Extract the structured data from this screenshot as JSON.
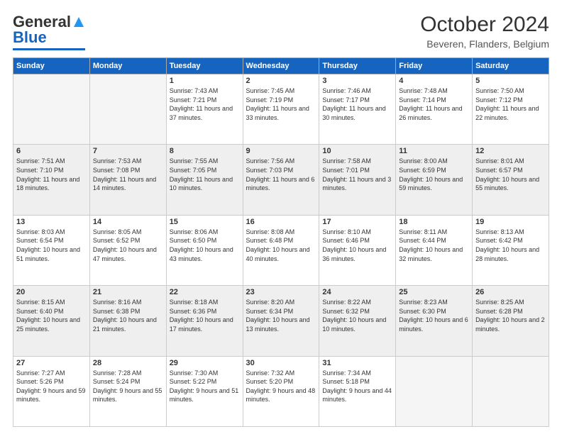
{
  "header": {
    "logo_general": "General",
    "logo_blue": "Blue",
    "month_year": "October 2024",
    "location": "Beveren, Flanders, Belgium"
  },
  "days_of_week": [
    "Sunday",
    "Monday",
    "Tuesday",
    "Wednesday",
    "Thursday",
    "Friday",
    "Saturday"
  ],
  "weeks": [
    [
      {
        "day": "",
        "sunrise": "",
        "sunset": "",
        "daylight": "",
        "empty": true
      },
      {
        "day": "",
        "sunrise": "",
        "sunset": "",
        "daylight": "",
        "empty": true
      },
      {
        "day": "1",
        "sunrise": "Sunrise: 7:43 AM",
        "sunset": "Sunset: 7:21 PM",
        "daylight": "Daylight: 11 hours and 37 minutes.",
        "empty": false
      },
      {
        "day": "2",
        "sunrise": "Sunrise: 7:45 AM",
        "sunset": "Sunset: 7:19 PM",
        "daylight": "Daylight: 11 hours and 33 minutes.",
        "empty": false
      },
      {
        "day": "3",
        "sunrise": "Sunrise: 7:46 AM",
        "sunset": "Sunset: 7:17 PM",
        "daylight": "Daylight: 11 hours and 30 minutes.",
        "empty": false
      },
      {
        "day": "4",
        "sunrise": "Sunrise: 7:48 AM",
        "sunset": "Sunset: 7:14 PM",
        "daylight": "Daylight: 11 hours and 26 minutes.",
        "empty": false
      },
      {
        "day": "5",
        "sunrise": "Sunrise: 7:50 AM",
        "sunset": "Sunset: 7:12 PM",
        "daylight": "Daylight: 11 hours and 22 minutes.",
        "empty": false
      }
    ],
    [
      {
        "day": "6",
        "sunrise": "Sunrise: 7:51 AM",
        "sunset": "Sunset: 7:10 PM",
        "daylight": "Daylight: 11 hours and 18 minutes.",
        "empty": false
      },
      {
        "day": "7",
        "sunrise": "Sunrise: 7:53 AM",
        "sunset": "Sunset: 7:08 PM",
        "daylight": "Daylight: 11 hours and 14 minutes.",
        "empty": false
      },
      {
        "day": "8",
        "sunrise": "Sunrise: 7:55 AM",
        "sunset": "Sunset: 7:05 PM",
        "daylight": "Daylight: 11 hours and 10 minutes.",
        "empty": false
      },
      {
        "day": "9",
        "sunrise": "Sunrise: 7:56 AM",
        "sunset": "Sunset: 7:03 PM",
        "daylight": "Daylight: 11 hours and 6 minutes.",
        "empty": false
      },
      {
        "day": "10",
        "sunrise": "Sunrise: 7:58 AM",
        "sunset": "Sunset: 7:01 PM",
        "daylight": "Daylight: 11 hours and 3 minutes.",
        "empty": false
      },
      {
        "day": "11",
        "sunrise": "Sunrise: 8:00 AM",
        "sunset": "Sunset: 6:59 PM",
        "daylight": "Daylight: 10 hours and 59 minutes.",
        "empty": false
      },
      {
        "day": "12",
        "sunrise": "Sunrise: 8:01 AM",
        "sunset": "Sunset: 6:57 PM",
        "daylight": "Daylight: 10 hours and 55 minutes.",
        "empty": false
      }
    ],
    [
      {
        "day": "13",
        "sunrise": "Sunrise: 8:03 AM",
        "sunset": "Sunset: 6:54 PM",
        "daylight": "Daylight: 10 hours and 51 minutes.",
        "empty": false
      },
      {
        "day": "14",
        "sunrise": "Sunrise: 8:05 AM",
        "sunset": "Sunset: 6:52 PM",
        "daylight": "Daylight: 10 hours and 47 minutes.",
        "empty": false
      },
      {
        "day": "15",
        "sunrise": "Sunrise: 8:06 AM",
        "sunset": "Sunset: 6:50 PM",
        "daylight": "Daylight: 10 hours and 43 minutes.",
        "empty": false
      },
      {
        "day": "16",
        "sunrise": "Sunrise: 8:08 AM",
        "sunset": "Sunset: 6:48 PM",
        "daylight": "Daylight: 10 hours and 40 minutes.",
        "empty": false
      },
      {
        "day": "17",
        "sunrise": "Sunrise: 8:10 AM",
        "sunset": "Sunset: 6:46 PM",
        "daylight": "Daylight: 10 hours and 36 minutes.",
        "empty": false
      },
      {
        "day": "18",
        "sunrise": "Sunrise: 8:11 AM",
        "sunset": "Sunset: 6:44 PM",
        "daylight": "Daylight: 10 hours and 32 minutes.",
        "empty": false
      },
      {
        "day": "19",
        "sunrise": "Sunrise: 8:13 AM",
        "sunset": "Sunset: 6:42 PM",
        "daylight": "Daylight: 10 hours and 28 minutes.",
        "empty": false
      }
    ],
    [
      {
        "day": "20",
        "sunrise": "Sunrise: 8:15 AM",
        "sunset": "Sunset: 6:40 PM",
        "daylight": "Daylight: 10 hours and 25 minutes.",
        "empty": false
      },
      {
        "day": "21",
        "sunrise": "Sunrise: 8:16 AM",
        "sunset": "Sunset: 6:38 PM",
        "daylight": "Daylight: 10 hours and 21 minutes.",
        "empty": false
      },
      {
        "day": "22",
        "sunrise": "Sunrise: 8:18 AM",
        "sunset": "Sunset: 6:36 PM",
        "daylight": "Daylight: 10 hours and 17 minutes.",
        "empty": false
      },
      {
        "day": "23",
        "sunrise": "Sunrise: 8:20 AM",
        "sunset": "Sunset: 6:34 PM",
        "daylight": "Daylight: 10 hours and 13 minutes.",
        "empty": false
      },
      {
        "day": "24",
        "sunrise": "Sunrise: 8:22 AM",
        "sunset": "Sunset: 6:32 PM",
        "daylight": "Daylight: 10 hours and 10 minutes.",
        "empty": false
      },
      {
        "day": "25",
        "sunrise": "Sunrise: 8:23 AM",
        "sunset": "Sunset: 6:30 PM",
        "daylight": "Daylight: 10 hours and 6 minutes.",
        "empty": false
      },
      {
        "day": "26",
        "sunrise": "Sunrise: 8:25 AM",
        "sunset": "Sunset: 6:28 PM",
        "daylight": "Daylight: 10 hours and 2 minutes.",
        "empty": false
      }
    ],
    [
      {
        "day": "27",
        "sunrise": "Sunrise: 7:27 AM",
        "sunset": "Sunset: 5:26 PM",
        "daylight": "Daylight: 9 hours and 59 minutes.",
        "empty": false
      },
      {
        "day": "28",
        "sunrise": "Sunrise: 7:28 AM",
        "sunset": "Sunset: 5:24 PM",
        "daylight": "Daylight: 9 hours and 55 minutes.",
        "empty": false
      },
      {
        "day": "29",
        "sunrise": "Sunrise: 7:30 AM",
        "sunset": "Sunset: 5:22 PM",
        "daylight": "Daylight: 9 hours and 51 minutes.",
        "empty": false
      },
      {
        "day": "30",
        "sunrise": "Sunrise: 7:32 AM",
        "sunset": "Sunset: 5:20 PM",
        "daylight": "Daylight: 9 hours and 48 minutes.",
        "empty": false
      },
      {
        "day": "31",
        "sunrise": "Sunrise: 7:34 AM",
        "sunset": "Sunset: 5:18 PM",
        "daylight": "Daylight: 9 hours and 44 minutes.",
        "empty": false
      },
      {
        "day": "",
        "sunrise": "",
        "sunset": "",
        "daylight": "",
        "empty": true
      },
      {
        "day": "",
        "sunrise": "",
        "sunset": "",
        "daylight": "",
        "empty": true
      }
    ]
  ]
}
